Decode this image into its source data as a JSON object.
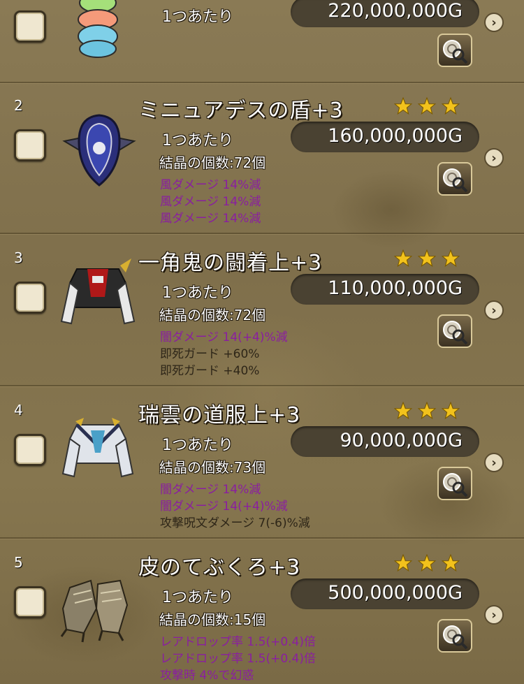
{
  "rows": [
    {
      "number": "",
      "name": "",
      "unit_label": "1つあたり",
      "price": "220,000,000G",
      "crystal": "",
      "effects": []
    },
    {
      "number": "2",
      "name": "ミニュアデスの盾+3",
      "unit_label": "1つあたり",
      "price": "160,000,000G",
      "crystal": "結晶の個数:72個",
      "effects": [
        {
          "text": "風ダメージ 14%減",
          "color": "purple"
        },
        {
          "text": "風ダメージ 14%減",
          "color": "purple"
        },
        {
          "text": "風ダメージ 14%減",
          "color": "purple"
        }
      ]
    },
    {
      "number": "3",
      "name": "一角鬼の闘着上+3",
      "unit_label": "1つあたり",
      "price": "110,000,000G",
      "crystal": "結晶の個数:72個",
      "effects": [
        {
          "text": "闇ダメージ 14(+4)%減",
          "color": "purple"
        },
        {
          "text": "即死ガード +60%",
          "color": "dark"
        },
        {
          "text": "即死ガード +40%",
          "color": "dark"
        }
      ]
    },
    {
      "number": "4",
      "name": "瑞雲の道服上+3",
      "unit_label": "1つあたり",
      "price": "90,000,000G",
      "crystal": "結晶の個数:73個",
      "effects": [
        {
          "text": "闇ダメージ 14%減",
          "color": "purple"
        },
        {
          "text": "闇ダメージ 14(+4)%減",
          "color": "purple"
        },
        {
          "text": "攻撃呪文ダメージ 7(-6)%減",
          "color": "dark"
        }
      ]
    },
    {
      "number": "5",
      "name": "皮のてぶくろ+3",
      "unit_label": "1つあたり",
      "price": "500,000,000G",
      "crystal": "結晶の個数:15個",
      "effects": [
        {
          "text": "レアドロップ率 1.5(+0.4)倍",
          "color": "purple"
        },
        {
          "text": "レアドロップ率 1.5(+0.4)倍",
          "color": "purple"
        },
        {
          "text": "攻撃時 4%で幻惑",
          "color": "purple"
        }
      ]
    }
  ],
  "stars_per_item": 3,
  "colors": {
    "effect_purple": "#8a1ea0",
    "effect_dark": "#2e2618",
    "star_gold": "#f2c21c",
    "price_pill": "#4a4232"
  }
}
